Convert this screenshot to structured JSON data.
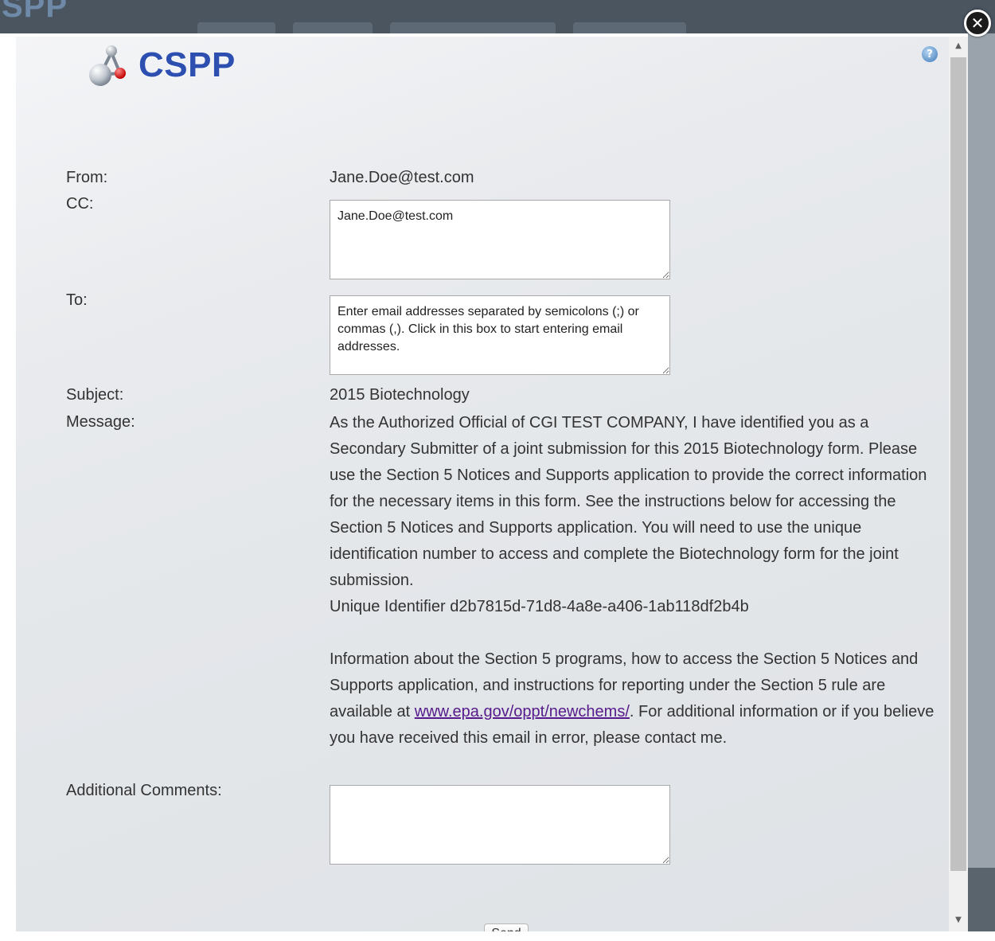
{
  "background": {
    "logo_text": "SPP"
  },
  "header": {
    "logo_text": "CSPP",
    "help_icon": "?"
  },
  "close_glyph": "✕",
  "form": {
    "from": {
      "label": "From:",
      "value": "Jane.Doe@test.com"
    },
    "cc": {
      "label": "CC:",
      "value": "Jane.Doe@test.com"
    },
    "to": {
      "label": "To:",
      "placeholder": "Enter email addresses separated by semicolons (;) or commas (,). Click in this box to start entering email addresses."
    },
    "subject": {
      "label": "Subject:",
      "value": "2015 Biotechnology"
    },
    "message": {
      "label": "Message:",
      "paragraph1": "As the Authorized Official of CGI TEST COMPANY, I have identified you as a Secondary Submitter of a joint submission for this 2015 Biotechnology form. Please use the Section 5 Notices and Supports application to provide the correct information for the necessary items in this form. See the instructions below for accessing the Section 5 Notices and Supports application. You will need to use the unique identification number to access and complete the Biotechnology form for the joint submission.",
      "identifier_line": "Unique Identifier d2b7815d-71d8-4a8e-a406-1ab118df2b4b",
      "paragraph2_before": "Information about the Section 5 programs, how to access the Section 5 Notices and Supports application, and instructions for reporting under the Section 5 rule are available at ",
      "link_text": "www.epa.gov/oppt/newchems/",
      "paragraph2_after": ". For additional information or if you believe you have received this email in error, please contact me."
    },
    "comments": {
      "label": "Additional Comments:",
      "value": ""
    },
    "send_label": "Send"
  },
  "scrollbar": {
    "up": "▲",
    "down": "▼"
  },
  "colors": {
    "logo_blue": "#2d4fb0",
    "link": "#551a8b",
    "header_bg": "#4a5560"
  }
}
